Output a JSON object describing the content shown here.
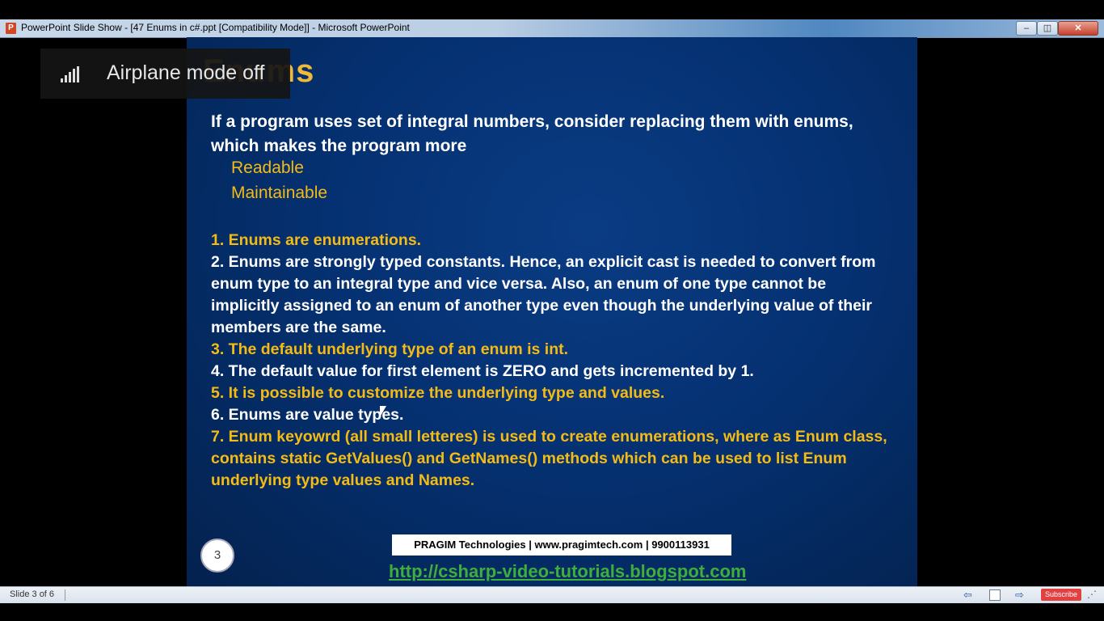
{
  "window": {
    "title": "PowerPoint Slide Show - [47 Enums in c#.ppt [Compatibility Mode]] - Microsoft PowerPoint",
    "app_icon_letter": "P",
    "minimize": "‒",
    "maximize": "◫",
    "close": "✕"
  },
  "toast": {
    "text": "Airplane mode off"
  },
  "slide": {
    "title": "Enums",
    "intro": "If a program uses set of integral numbers, consider replacing them with enums, which makes the program more",
    "sub_items": [
      "Readable",
      "Maintainable"
    ],
    "points": [
      "1. Enums are enumerations.",
      "2. Enums are strongly typed constants. Hence, an explicit cast is needed to convert from enum type to an integral type and vice versa. Also, an enum of one type cannot be implicitly assigned to an enum of another type even though the underlying value of their members are the same.",
      "3. The default underlying type of an enum is int.",
      "4. The default value for first element is ZERO and gets incremented by 1.",
      "5. It is possible to customize the underlying type and values.",
      "6. Enums are value types.",
      "7. Enum keyowrd (all small letteres) is used to create enumerations, where as Enum class, contains static GetValues() and GetNames() methods which can be used to list Enum underlying type values and Names."
    ],
    "number": "3",
    "footer": "PRAGIM Technologies | www.pragimtech.com | 9900113931",
    "link": "http://csharp-video-tutorials.blogspot.com"
  },
  "statusbar": {
    "slide_indicator": "Slide 3 of 6",
    "subscribe": "Subscribe"
  },
  "colors": {
    "slide_bg": "#053172",
    "accent_yellow": "#f5bb15",
    "title_gold": "#f0b93a",
    "link_green": "#3fae3c"
  }
}
